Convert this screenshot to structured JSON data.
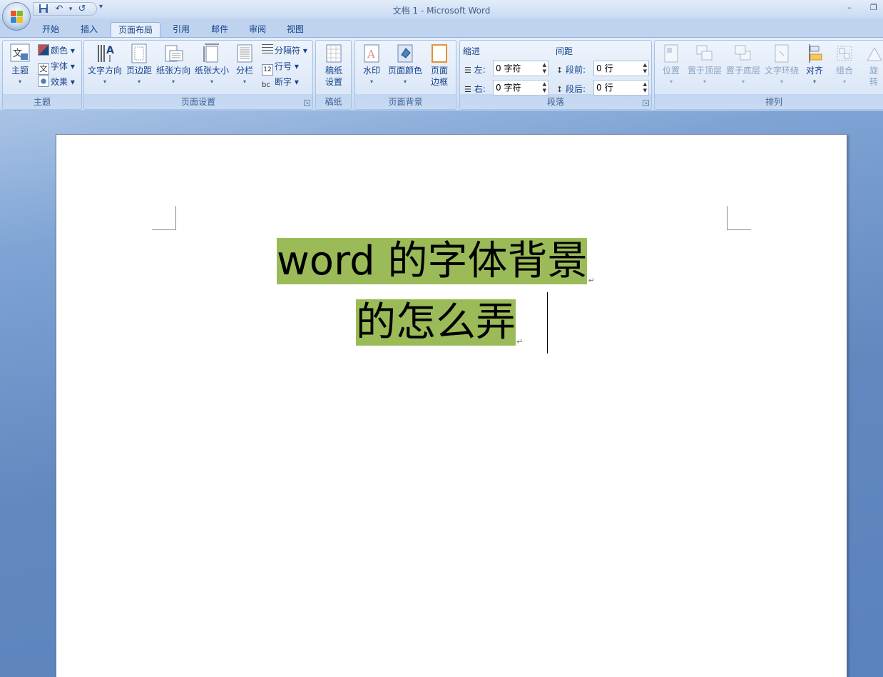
{
  "window": {
    "title": "文档 1 - Microsoft Word",
    "minimize_glyph": "–",
    "restore_glyph": "❐"
  },
  "quick_access": {
    "icons": [
      "save-icon",
      "undo-icon",
      "redo-icon"
    ],
    "undo_glyph": "↶",
    "redo_glyph": "↺",
    "customize_glyph": "▾"
  },
  "tabs": [
    {
      "label": "开始"
    },
    {
      "label": "插入"
    },
    {
      "label": "页面布局",
      "active": true
    },
    {
      "label": "引用"
    },
    {
      "label": "邮件"
    },
    {
      "label": "审阅"
    },
    {
      "label": "视图"
    }
  ],
  "ribbon": {
    "themes": {
      "group_label": "主题",
      "theme_button": "主题",
      "colors": "颜色",
      "fonts": "字体",
      "effects": "效果"
    },
    "page_setup": {
      "group_label": "页面设置",
      "text_direction": "文字方向",
      "margins": "页边距",
      "orientation": "纸张方向",
      "size": "纸张大小",
      "columns": "分栏",
      "breaks": "分隔符",
      "line_numbers": "行号",
      "hyphenation": "断字"
    },
    "manuscript": {
      "group_label": "稿纸",
      "button_line1": "稿纸",
      "button_line2": "设置"
    },
    "page_background": {
      "group_label": "页面背景",
      "watermark": "水印",
      "page_color": "页面颜色",
      "borders_line1": "页面",
      "borders_line2": "边框"
    },
    "paragraph": {
      "group_label": "段落",
      "indent_header": "缩进",
      "spacing_header": "间距",
      "left_label": "左:",
      "right_label": "右:",
      "before_label": "段前:",
      "after_label": "段后:",
      "left_value": "0 字符",
      "right_value": "0 字符",
      "before_value": "0 行",
      "after_value": "0 行"
    },
    "arrange": {
      "group_label": "排列",
      "position": "位置",
      "bring_front": "置于顶层",
      "send_back": "置于底层",
      "text_wrap": "文字环绕",
      "align": "对齐",
      "group": "组合",
      "rotate_line1": "旋",
      "rotate_line2": "转"
    }
  },
  "document": {
    "line1": "word 的字体背景",
    "line2": "的怎么弄",
    "paragraph_mark": "↵",
    "highlight_color": "#9bbb59"
  },
  "colors": {
    "ribbon_bg": "#dbe7f7",
    "tab_text": "#15428b",
    "workspace_bg": "#6288c0"
  }
}
